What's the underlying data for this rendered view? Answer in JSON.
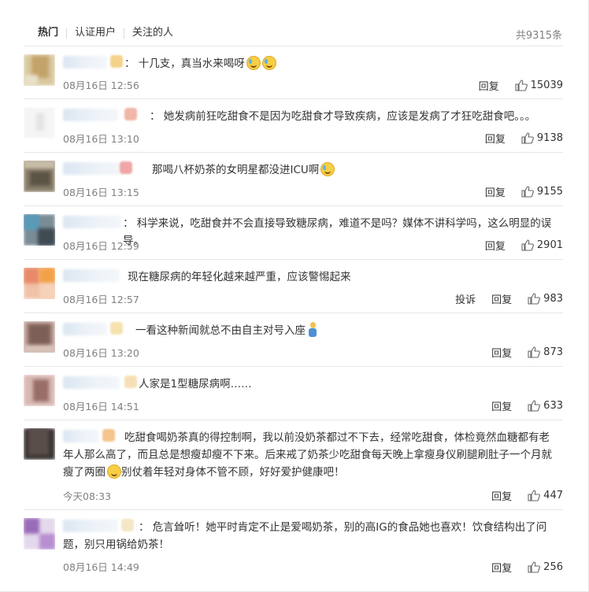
{
  "header": {
    "tabs": [
      "热门",
      "认证用户",
      "关注的人"
    ],
    "total": "共9315条"
  },
  "labels": {
    "reply": "回复",
    "report": "投诉"
  },
  "comments": [
    {
      "text": "：  十几支，真当水来喝呀",
      "time": "08月16日 12:56",
      "likes": "15039",
      "emoji": "laugh-cry-emoji ×2"
    },
    {
      "text": "：  她发病前狂吃甜食不是因为吃甜食才导致疾病，应该是发病了才狂吃甜食吧。。。",
      "time": "08月16日 13:10",
      "likes": "9138"
    },
    {
      "text": "那喝八杯奶茶的女明星都没进ICU啊",
      "time": "08月16日 13:15",
      "likes": "9155",
      "emoji": "laugh-cry-emoji"
    },
    {
      "text": "：  科学来说，吃甜食并不会直接导致糖尿病，难道不是吗？媒体不讲科学吗，这么明显的误导。",
      "time": "08月16日 12:59",
      "likes": "2901"
    },
    {
      "text": "现在糖尿病的年轻化越来越严重，应该警惕起来",
      "time": "08月16日 12:57",
      "likes": "983"
    },
    {
      "text": "一看这种新闻就总不由自主对号入座",
      "time": "08月16日 13:20",
      "likes": "873",
      "emoji": "person-emoji"
    },
    {
      "text": "人家是1型糖尿病啊……",
      "time": "08月16日 14:51",
      "likes": "633"
    },
    {
      "text": "吃甜食喝奶茶真的得控制啊，我以前没奶茶都过不下去，经常吃甜食，体检竟然血糖都有老年人那么高了，而且总是想瘦却瘦不下来。后来戒了奶茶少吃甜食每天晚上拿瘦身仪刷腿刷肚子一个月就瘦了两圈",
      "text_tail": "别仗着年轻对身体不管不顾，好好爱护健康吧！",
      "time": "今天08:33",
      "likes": "447",
      "emoji": "grin-emoji"
    },
    {
      "text": "：  危言耸听！她平时肯定不止是爱喝奶茶，别的高IG的食品她也喜欢！饮食结构出了问题，别只用锅给奶茶！",
      "time": "08月16日 14:49",
      "likes": "256"
    }
  ]
}
